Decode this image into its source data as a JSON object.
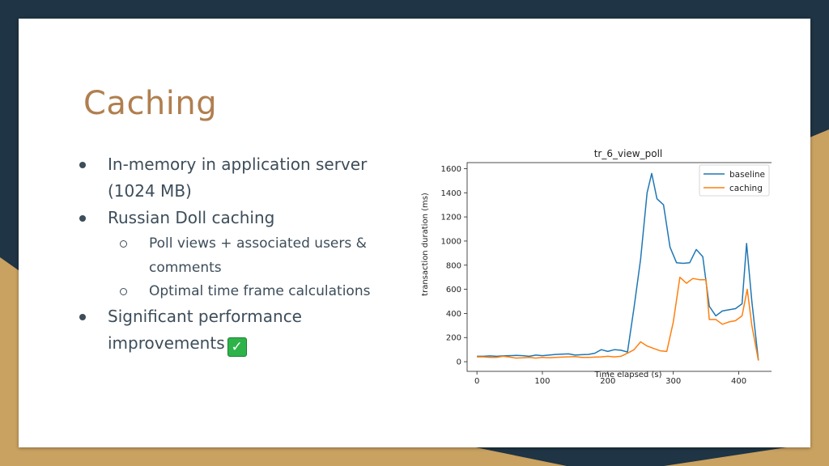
{
  "slide": {
    "title": "Caching",
    "bullets": {
      "b1_line1": "In-memory in application server",
      "b1_line2": "(1024 MB)",
      "b2": "Russian Doll caching",
      "b2_sub1_line1": "Poll views + associated users &",
      "b2_sub1_line2": "comments",
      "b2_sub2": "Optimal time frame calculations",
      "b3_line1": "Significant performance",
      "b3_line2": "improvements",
      "check_icon": "✓"
    }
  },
  "colors": {
    "title": "#b07f4f",
    "baseline": "#1f77b4",
    "caching": "#ff7f0e"
  },
  "chart_data": {
    "type": "line",
    "title": "tr_6_view_poll",
    "xlabel": "Time elapsed (s)",
    "ylabel": "transaction duration (ms)",
    "xlim": [
      -15,
      455
    ],
    "ylim": [
      -80,
      1650
    ],
    "xticks": [
      0,
      100,
      200,
      300,
      400
    ],
    "yticks": [
      0,
      200,
      400,
      600,
      800,
      1000,
      1200,
      1400,
      1600
    ],
    "legend": "top-right",
    "grid": false,
    "series": [
      {
        "name": "baseline",
        "color": "#1f77b4",
        "points": [
          [
            0,
            45
          ],
          [
            10,
            45
          ],
          [
            20,
            48
          ],
          [
            30,
            45
          ],
          [
            40,
            48
          ],
          [
            50,
            50
          ],
          [
            60,
            52
          ],
          [
            70,
            50
          ],
          [
            80,
            45
          ],
          [
            90,
            55
          ],
          [
            100,
            50
          ],
          [
            110,
            55
          ],
          [
            120,
            60
          ],
          [
            130,
            62
          ],
          [
            140,
            65
          ],
          [
            150,
            55
          ],
          [
            160,
            58
          ],
          [
            170,
            60
          ],
          [
            180,
            70
          ],
          [
            190,
            100
          ],
          [
            200,
            85
          ],
          [
            210,
            100
          ],
          [
            220,
            95
          ],
          [
            230,
            80
          ],
          [
            240,
            450
          ],
          [
            250,
            850
          ],
          [
            260,
            1400
          ],
          [
            267,
            1560
          ],
          [
            275,
            1350
          ],
          [
            285,
            1300
          ],
          [
            295,
            950
          ],
          [
            305,
            820
          ],
          [
            315,
            815
          ],
          [
            325,
            820
          ],
          [
            335,
            930
          ],
          [
            345,
            870
          ],
          [
            355,
            460
          ],
          [
            365,
            380
          ],
          [
            375,
            420
          ],
          [
            385,
            430
          ],
          [
            395,
            440
          ],
          [
            405,
            480
          ],
          [
            412,
            980
          ],
          [
            420,
            500
          ],
          [
            430,
            10
          ]
        ]
      },
      {
        "name": "caching",
        "color": "#ff7f0e",
        "points": [
          [
            0,
            40
          ],
          [
            10,
            40
          ],
          [
            20,
            35
          ],
          [
            30,
            35
          ],
          [
            40,
            45
          ],
          [
            50,
            38
          ],
          [
            60,
            30
          ],
          [
            70,
            32
          ],
          [
            80,
            35
          ],
          [
            90,
            30
          ],
          [
            100,
            35
          ],
          [
            110,
            32
          ],
          [
            120,
            35
          ],
          [
            130,
            38
          ],
          [
            140,
            40
          ],
          [
            150,
            42
          ],
          [
            160,
            35
          ],
          [
            170,
            35
          ],
          [
            180,
            38
          ],
          [
            190,
            40
          ],
          [
            200,
            45
          ],
          [
            210,
            40
          ],
          [
            220,
            45
          ],
          [
            230,
            70
          ],
          [
            240,
            100
          ],
          [
            250,
            165
          ],
          [
            260,
            130
          ],
          [
            270,
            110
          ],
          [
            280,
            90
          ],
          [
            290,
            85
          ],
          [
            300,
            330
          ],
          [
            310,
            700
          ],
          [
            320,
            650
          ],
          [
            330,
            690
          ],
          [
            340,
            680
          ],
          [
            350,
            680
          ],
          [
            355,
            350
          ],
          [
            365,
            350
          ],
          [
            375,
            310
          ],
          [
            385,
            330
          ],
          [
            395,
            340
          ],
          [
            405,
            380
          ],
          [
            413,
            600
          ],
          [
            420,
            300
          ],
          [
            430,
            10
          ]
        ]
      }
    ]
  }
}
